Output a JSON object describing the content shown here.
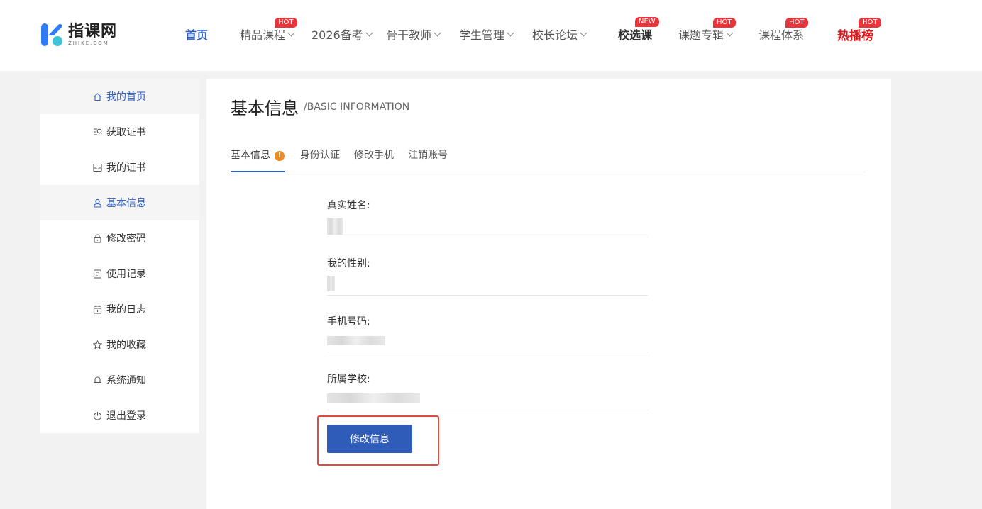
{
  "brand": {
    "name": "指课网",
    "sub": "ZHIKE.COM",
    "color": "#2f5fc4"
  },
  "nav": [
    {
      "label": "首页"
    },
    {
      "label": "精品课程",
      "badge": "HOT"
    },
    {
      "label": "2026备考"
    },
    {
      "label": "骨干教师"
    },
    {
      "label": "学生管理"
    },
    {
      "label": "校长论坛"
    },
    {
      "label": "校选课",
      "badge": "NEW"
    },
    {
      "label": "课题专辑",
      "badge": "HOT"
    },
    {
      "label": "课程体系",
      "badge": "HOT"
    },
    {
      "label": "热播榜",
      "badge": "HOT"
    }
  ],
  "sidebar": {
    "items": [
      {
        "label": "我的首页",
        "icon": "home-icon"
      },
      {
        "label": "获取证书",
        "icon": "search-list-icon"
      },
      {
        "label": "我的证书",
        "icon": "certificate-icon"
      },
      {
        "label": "基本信息",
        "icon": "user-icon"
      },
      {
        "label": "修改密码",
        "icon": "lock-icon"
      },
      {
        "label": "使用记录",
        "icon": "record-icon"
      },
      {
        "label": "我的日志",
        "icon": "calendar-icon"
      },
      {
        "label": "我的收藏",
        "icon": "star-icon"
      },
      {
        "label": "系统通知",
        "icon": "bell-icon"
      },
      {
        "label": "退出登录",
        "icon": "power-icon"
      }
    ]
  },
  "main": {
    "title": "基本信息",
    "subtitle": "/BASIC INFORMATION",
    "tabs": [
      {
        "label": "基本信息",
        "warn": "!"
      },
      {
        "label": "身份认证"
      },
      {
        "label": "修改手机"
      },
      {
        "label": "注销账号"
      }
    ],
    "fields": [
      {
        "label": "真实姓名:"
      },
      {
        "label": "我的性别:"
      },
      {
        "label": "手机号码:"
      },
      {
        "label": "所属学校:"
      }
    ],
    "button": "修改信息"
  },
  "colors": {
    "accent": "#2f5cb8",
    "hot": "#e8343a",
    "highlight_frame": "#e04a43",
    "warn": "#f08a24"
  }
}
